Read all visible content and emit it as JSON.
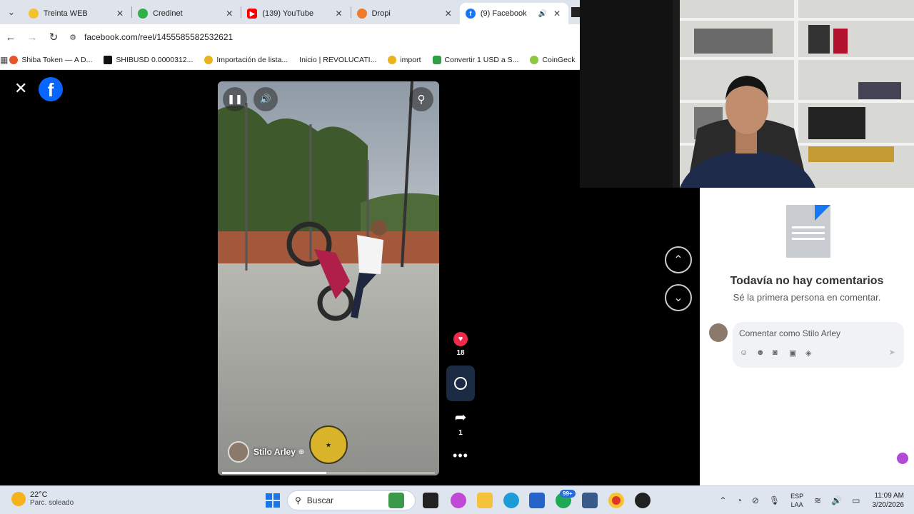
{
  "browser": {
    "tabs": [
      {
        "title": "Treinta WEB",
        "favicon_color": "#f2c230",
        "active": false
      },
      {
        "title": "Credinet",
        "favicon_color": "#2fb14a",
        "active": false
      },
      {
        "title": "(139) YouTube",
        "favicon_color": "#ff0000",
        "active": false
      },
      {
        "title": "Dropi",
        "favicon_color": "#f07a2a",
        "active": false
      },
      {
        "title": "(9) Facebook",
        "favicon_color": "#1877f2",
        "active": true
      }
    ],
    "url": "facebook.com/reel/1455585582532621",
    "bookmarks": [
      {
        "label": "Shiba Token — A D...",
        "color": "#e8542a"
      },
      {
        "label": "SHIBUSD 0.0000312...",
        "color": "#111111"
      },
      {
        "label": "Importación de lista...",
        "color": "#e9b31b"
      },
      {
        "label": "Inicio | REVOLUCATI...",
        "color": "#ffffff"
      },
      {
        "label": "import",
        "color": "#e9b31b"
      },
      {
        "label": "Convertir 1 USD a S...",
        "color": "#2ea043"
      },
      {
        "label": "CoinGeck",
        "color": "#8dc63f"
      }
    ]
  },
  "reel": {
    "author": "Stilo Arley",
    "like_count": "18",
    "share_count": "1",
    "progress_fraction": 0.49
  },
  "comments": {
    "empty_title": "Todavía no hay comentarios",
    "empty_subtitle": "Sé la primera persona en comentar.",
    "input_placeholder": "Comentar como Stilo Arley"
  },
  "taskbar": {
    "temperature": "22°C",
    "weather": "Parc. soleado",
    "search_placeholder": "Buscar",
    "badge": "99+",
    "lang_top": "ESP",
    "lang_bottom": "LAA",
    "time": "11:09 AM",
    "date": "3/20/2026"
  }
}
